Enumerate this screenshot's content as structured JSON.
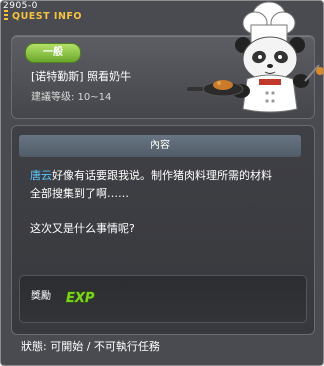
{
  "window": {
    "id_label": "2905-0",
    "title": "QUEST INFO"
  },
  "quest": {
    "category_badge": "一般",
    "name": "[诺特勤斯] 照看奶牛",
    "level_text": "建議等级: 10~14"
  },
  "content": {
    "header": "內容",
    "npc_name": "唐云",
    "line1_rest": "好像有话要跟我说。制作猪肉料理所需的材料",
    "line2": "全部搜集到了啊……",
    "line3": "这次又是什么事情呢?"
  },
  "reward": {
    "label": "獎勵",
    "exp_icon": "exp-icon",
    "exp_text": "EXP"
  },
  "status": {
    "text": "狀態: 可開始 / 不可執行任務"
  },
  "icons": {
    "npc": "panda-chef-npc-icon"
  },
  "colors": {
    "window_bg": "#4a4b50",
    "title": "#f5c242",
    "badge": "#8cc63f",
    "npc_name": "#57c6ff",
    "exp": "#7ed321"
  }
}
